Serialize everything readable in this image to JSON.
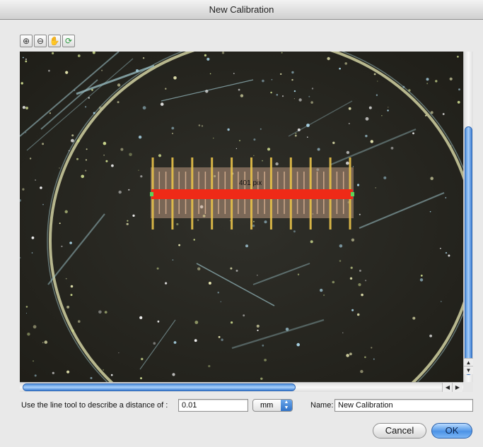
{
  "window": {
    "title": "New Calibration"
  },
  "toolbar": {
    "tools": [
      {
        "name": "zoom-in",
        "glyph": "⊕"
      },
      {
        "name": "zoom-out",
        "glyph": "⊖"
      },
      {
        "name": "pan-hand",
        "glyph": "✋"
      },
      {
        "name": "rotate",
        "glyph": "⟳"
      }
    ]
  },
  "viewer": {
    "measurement_label": "401 pix"
  },
  "calibration": {
    "distance_label": "Use the line tool to describe a distance of :",
    "distance_value": "0.01",
    "unit": "mm",
    "name_label": "Name:",
    "name_value": "New Calibration"
  },
  "buttons": {
    "cancel": "Cancel",
    "ok": "OK"
  },
  "colors": {
    "measure_line": "#ef2a17",
    "accent": "#3b82e0"
  }
}
